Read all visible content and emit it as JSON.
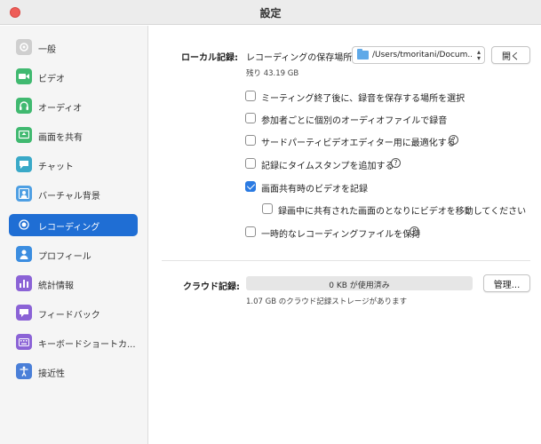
{
  "window": {
    "title": "設定"
  },
  "sidebar": {
    "items": [
      {
        "label": "一般",
        "icon": "gear-icon",
        "color": "#c9c9c9"
      },
      {
        "label": "ビデオ",
        "icon": "video-icon",
        "color": "#40b970"
      },
      {
        "label": "オーディオ",
        "icon": "headphones-icon",
        "color": "#40b970"
      },
      {
        "label": "画面を共有",
        "icon": "share-screen-icon",
        "color": "#40b970"
      },
      {
        "label": "チャット",
        "icon": "chat-icon",
        "color": "#3aa9c8"
      },
      {
        "label": "バーチャル背景",
        "icon": "person-background-icon",
        "color": "#4e9fe3"
      },
      {
        "label": "レコーディング",
        "icon": "record-icon",
        "color": "#1f6ed4"
      },
      {
        "label": "プロフィール",
        "icon": "person-icon",
        "color": "#3b8de0"
      },
      {
        "label": "統計情報",
        "icon": "stats-icon",
        "color": "#8b63d6"
      },
      {
        "label": "フィードバック",
        "icon": "feedback-icon",
        "color": "#8b63d6"
      },
      {
        "label": "キーボードショートカ...",
        "icon": "keyboard-icon",
        "color": "#8b63d6"
      },
      {
        "label": "接近性",
        "icon": "accessibility-icon",
        "color": "#4a7fd8"
      }
    ],
    "active_index": 6
  },
  "local": {
    "section_label": "ローカル記録:",
    "location_label": "レコーディングの保存場所:",
    "path_value": "/Users/tmoritani/Docum...",
    "open_button": "開く",
    "remaining": "残り 43.19 GB",
    "options": [
      {
        "label": "ミーティング終了後に、録音を保存する場所を選択",
        "checked": false,
        "help": false
      },
      {
        "label": "参加者ごとに個別のオーディオファイルで録音",
        "checked": false,
        "help": false
      },
      {
        "label": "サードパーティビデオエディター用に最適化する",
        "checked": false,
        "help": true
      },
      {
        "label": "記録にタイムスタンプを追加する",
        "checked": false,
        "help": true
      },
      {
        "label": "画面共有時のビデオを記録",
        "checked": true,
        "help": false
      },
      {
        "label": "録画中に共有された画面のとなりにビデオを移動してください",
        "checked": false,
        "help": false
      },
      {
        "label": "一時的なレコーディングファイルを保持",
        "checked": false,
        "help": true
      }
    ],
    "help_glyph": "?"
  },
  "cloud": {
    "section_label": "クラウド記録:",
    "usage_text": "0 KB が使用済み",
    "usage_fraction": 0,
    "manage_button": "管理...",
    "available": "1.07 GB のクラウド記録ストレージがあります"
  }
}
